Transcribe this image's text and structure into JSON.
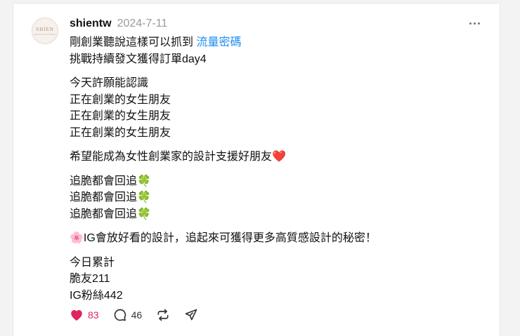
{
  "post": {
    "avatar": {
      "brand": "SHIEN",
      "brand_sub": "DESIGN STUDIO"
    },
    "username": "shientw",
    "date": "2024-7-11",
    "more_icon": "more-horizontal-icon",
    "body": {
      "p1_line1_text": "剛創業聽說這樣可以抓到",
      "p1_line1_link": "流量密碼",
      "p1_line2": "挑戰持續發文獲得訂單day4",
      "p2": [
        "今天許願能認識",
        "正在創業的女生朋友",
        "正在創業的女生朋友",
        "正在創業的女生朋友"
      ],
      "p3": "希望能成為女性創業家的設計支援好朋友❤️",
      "p4": [
        "追脆都會回追🍀",
        "追脆都會回追🍀",
        "追脆都會回追🍀"
      ],
      "p5": "🌸IG會放好看的設計，追起來可獲得更多高質感設計的秘密！",
      "p6": [
        "今日累計",
        "脆友211",
        "IG粉絲442"
      ]
    },
    "actions": {
      "likes": "83",
      "comments": "46",
      "like_icon": "heart-icon",
      "comment_icon": "comment-bubble-icon",
      "repost_icon": "repost-icon",
      "share_icon": "send-icon"
    }
  },
  "colors": {
    "link": "#1d8ef0",
    "like": "#e0245e",
    "muted": "#9a9a9a"
  }
}
